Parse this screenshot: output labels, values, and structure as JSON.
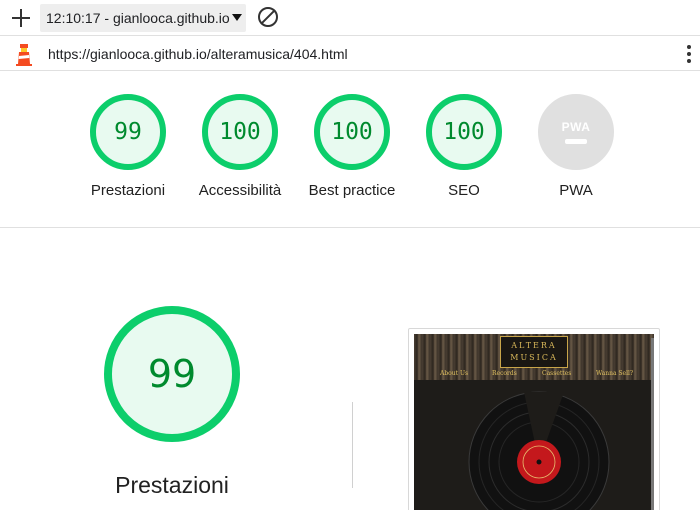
{
  "tab": {
    "select_value": "12:10:17 - gianlooca.github.io"
  },
  "url": "https://gianlooca.github.io/alteramusica/404.html",
  "icons": {
    "new": "plus-icon",
    "block": "block-icon",
    "lighthouse": "lighthouse-icon",
    "menu": "kebab-menu-icon"
  },
  "colors": {
    "pass": "#0cce6b",
    "pass_text": "#008a2e",
    "pass_bg": "#e8faf0",
    "na": "#e0e0e0"
  },
  "summary": [
    {
      "score": "99",
      "label": "Prestazioni"
    },
    {
      "score": "100",
      "label": "Accessibilità"
    },
    {
      "score": "100",
      "label": "Best practice"
    },
    {
      "score": "100",
      "label": "SEO"
    },
    {
      "badge": "PWA",
      "label": "PWA"
    }
  ],
  "detail": {
    "score": "99",
    "label": "Prestazioni"
  },
  "thumbnail": {
    "logo_line1": "ALTERA",
    "logo_line2": "MUSICA",
    "nav": [
      "About Us",
      "Records",
      "Cassettes",
      "Wanna Sell?"
    ]
  }
}
